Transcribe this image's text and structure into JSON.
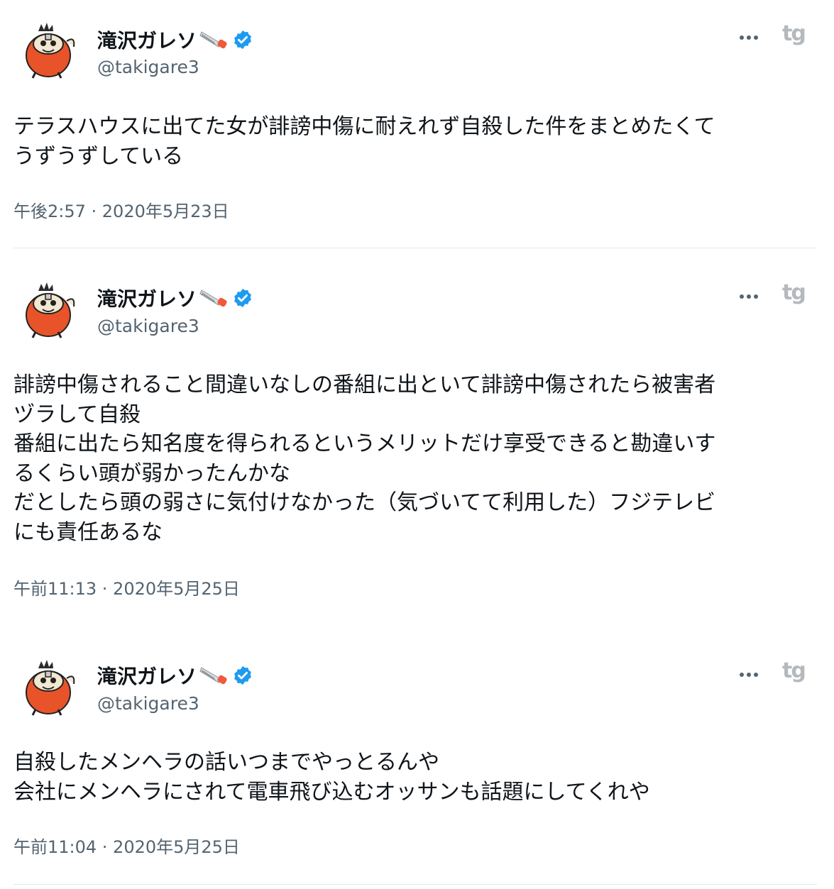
{
  "tweets": [
    {
      "author": "滝沢ガレソ",
      "handle": "@takigare3",
      "text": "テラスハウスに出てた女が誹謗中傷に耐えれず自殺した件をまとめたくて\nうずうずしている",
      "timestamp": "午後2:57 · 2020年5月23日"
    },
    {
      "author": "滝沢ガレソ",
      "handle": "@takigare3",
      "text": "誹謗中傷されること間違いなしの番組に出といて誹謗中傷されたら被害者\nヅラして自殺\n番組に出たら知名度を得られるというメリットだけ享受できると勘違いす\nるくらい頭が弱かったんかな\nだとしたら頭の弱さに気付けなかった（気づいてて利用した）フジテレビ\nにも責任あるな",
      "timestamp": "午前11:13 · 2020年5月25日"
    },
    {
      "author": "滝沢ガレソ",
      "handle": "@takigare3",
      "text": "自殺したメンヘラの話いつまでやっとるんや\n会社にメンヘラにされて電車飛び込むオッサンも話題にしてくれや",
      "timestamp": "午前11:04 · 2020年5月25日"
    }
  ],
  "watermark": "tg",
  "icons": {
    "verified": "verified-badge-icon",
    "more": "more-options-icon",
    "saw": "saw-emoji-icon"
  },
  "colors": {
    "verified": "#1d9bf0",
    "avatar": "#e8532a",
    "secondary_text": "#536471"
  }
}
